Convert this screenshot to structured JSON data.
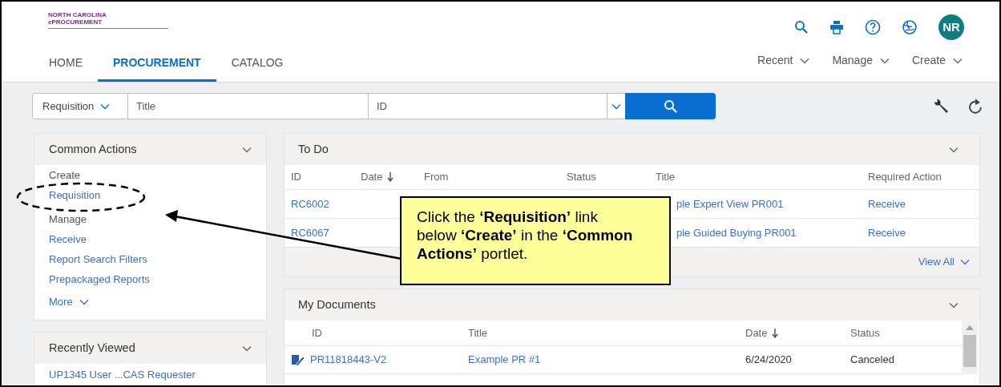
{
  "header": {
    "logo_text": "NORTH CAROLINA ePROCUREMENT",
    "avatar": "NR",
    "tabs": [
      {
        "label": "HOME",
        "selected": false
      },
      {
        "label": "PROCUREMENT",
        "selected": true
      },
      {
        "label": "CATALOG",
        "selected": false
      }
    ],
    "menus": [
      "Recent",
      "Manage",
      "Create"
    ]
  },
  "search": {
    "type": "Requisition",
    "title_placeholder": "Title",
    "id_placeholder": "ID"
  },
  "common_actions": {
    "title": "Common Actions",
    "more": "More",
    "items": [
      {
        "label": "Create",
        "kind": "heading"
      },
      {
        "label": "Requisition",
        "kind": "link"
      },
      {
        "label": "Manage",
        "kind": "heading"
      },
      {
        "label": "Receive",
        "kind": "link"
      },
      {
        "label": "Report Search Filters",
        "kind": "link"
      },
      {
        "label": "Prepackaged Reports",
        "kind": "link"
      }
    ]
  },
  "recently_viewed": {
    "title": "Recently Viewed",
    "items": [
      "UP1345 User ...CAS Requester"
    ]
  },
  "todo": {
    "title": "To Do",
    "view_all": "View All",
    "columns": [
      "ID",
      "Date",
      "From",
      "Status",
      "Title",
      "Required Action"
    ],
    "rows": [
      {
        "id": "RC6002",
        "title": "ple Expert View PR001",
        "action": "Receive"
      },
      {
        "id": "RC6067",
        "title": "ple Guided Buying PR001",
        "action": "Receive"
      }
    ]
  },
  "my_documents": {
    "title": "My Documents",
    "columns": [
      "ID",
      "Title",
      "Date",
      "Status"
    ],
    "rows": [
      {
        "id": "PR11818443-V2",
        "title": "Example PR #1",
        "date": "6/24/2020",
        "status": "Canceled"
      }
    ]
  },
  "callout": "Click the **‘Requisition’** link below **‘Create’** in the **‘Common Actions’** portlet."
}
